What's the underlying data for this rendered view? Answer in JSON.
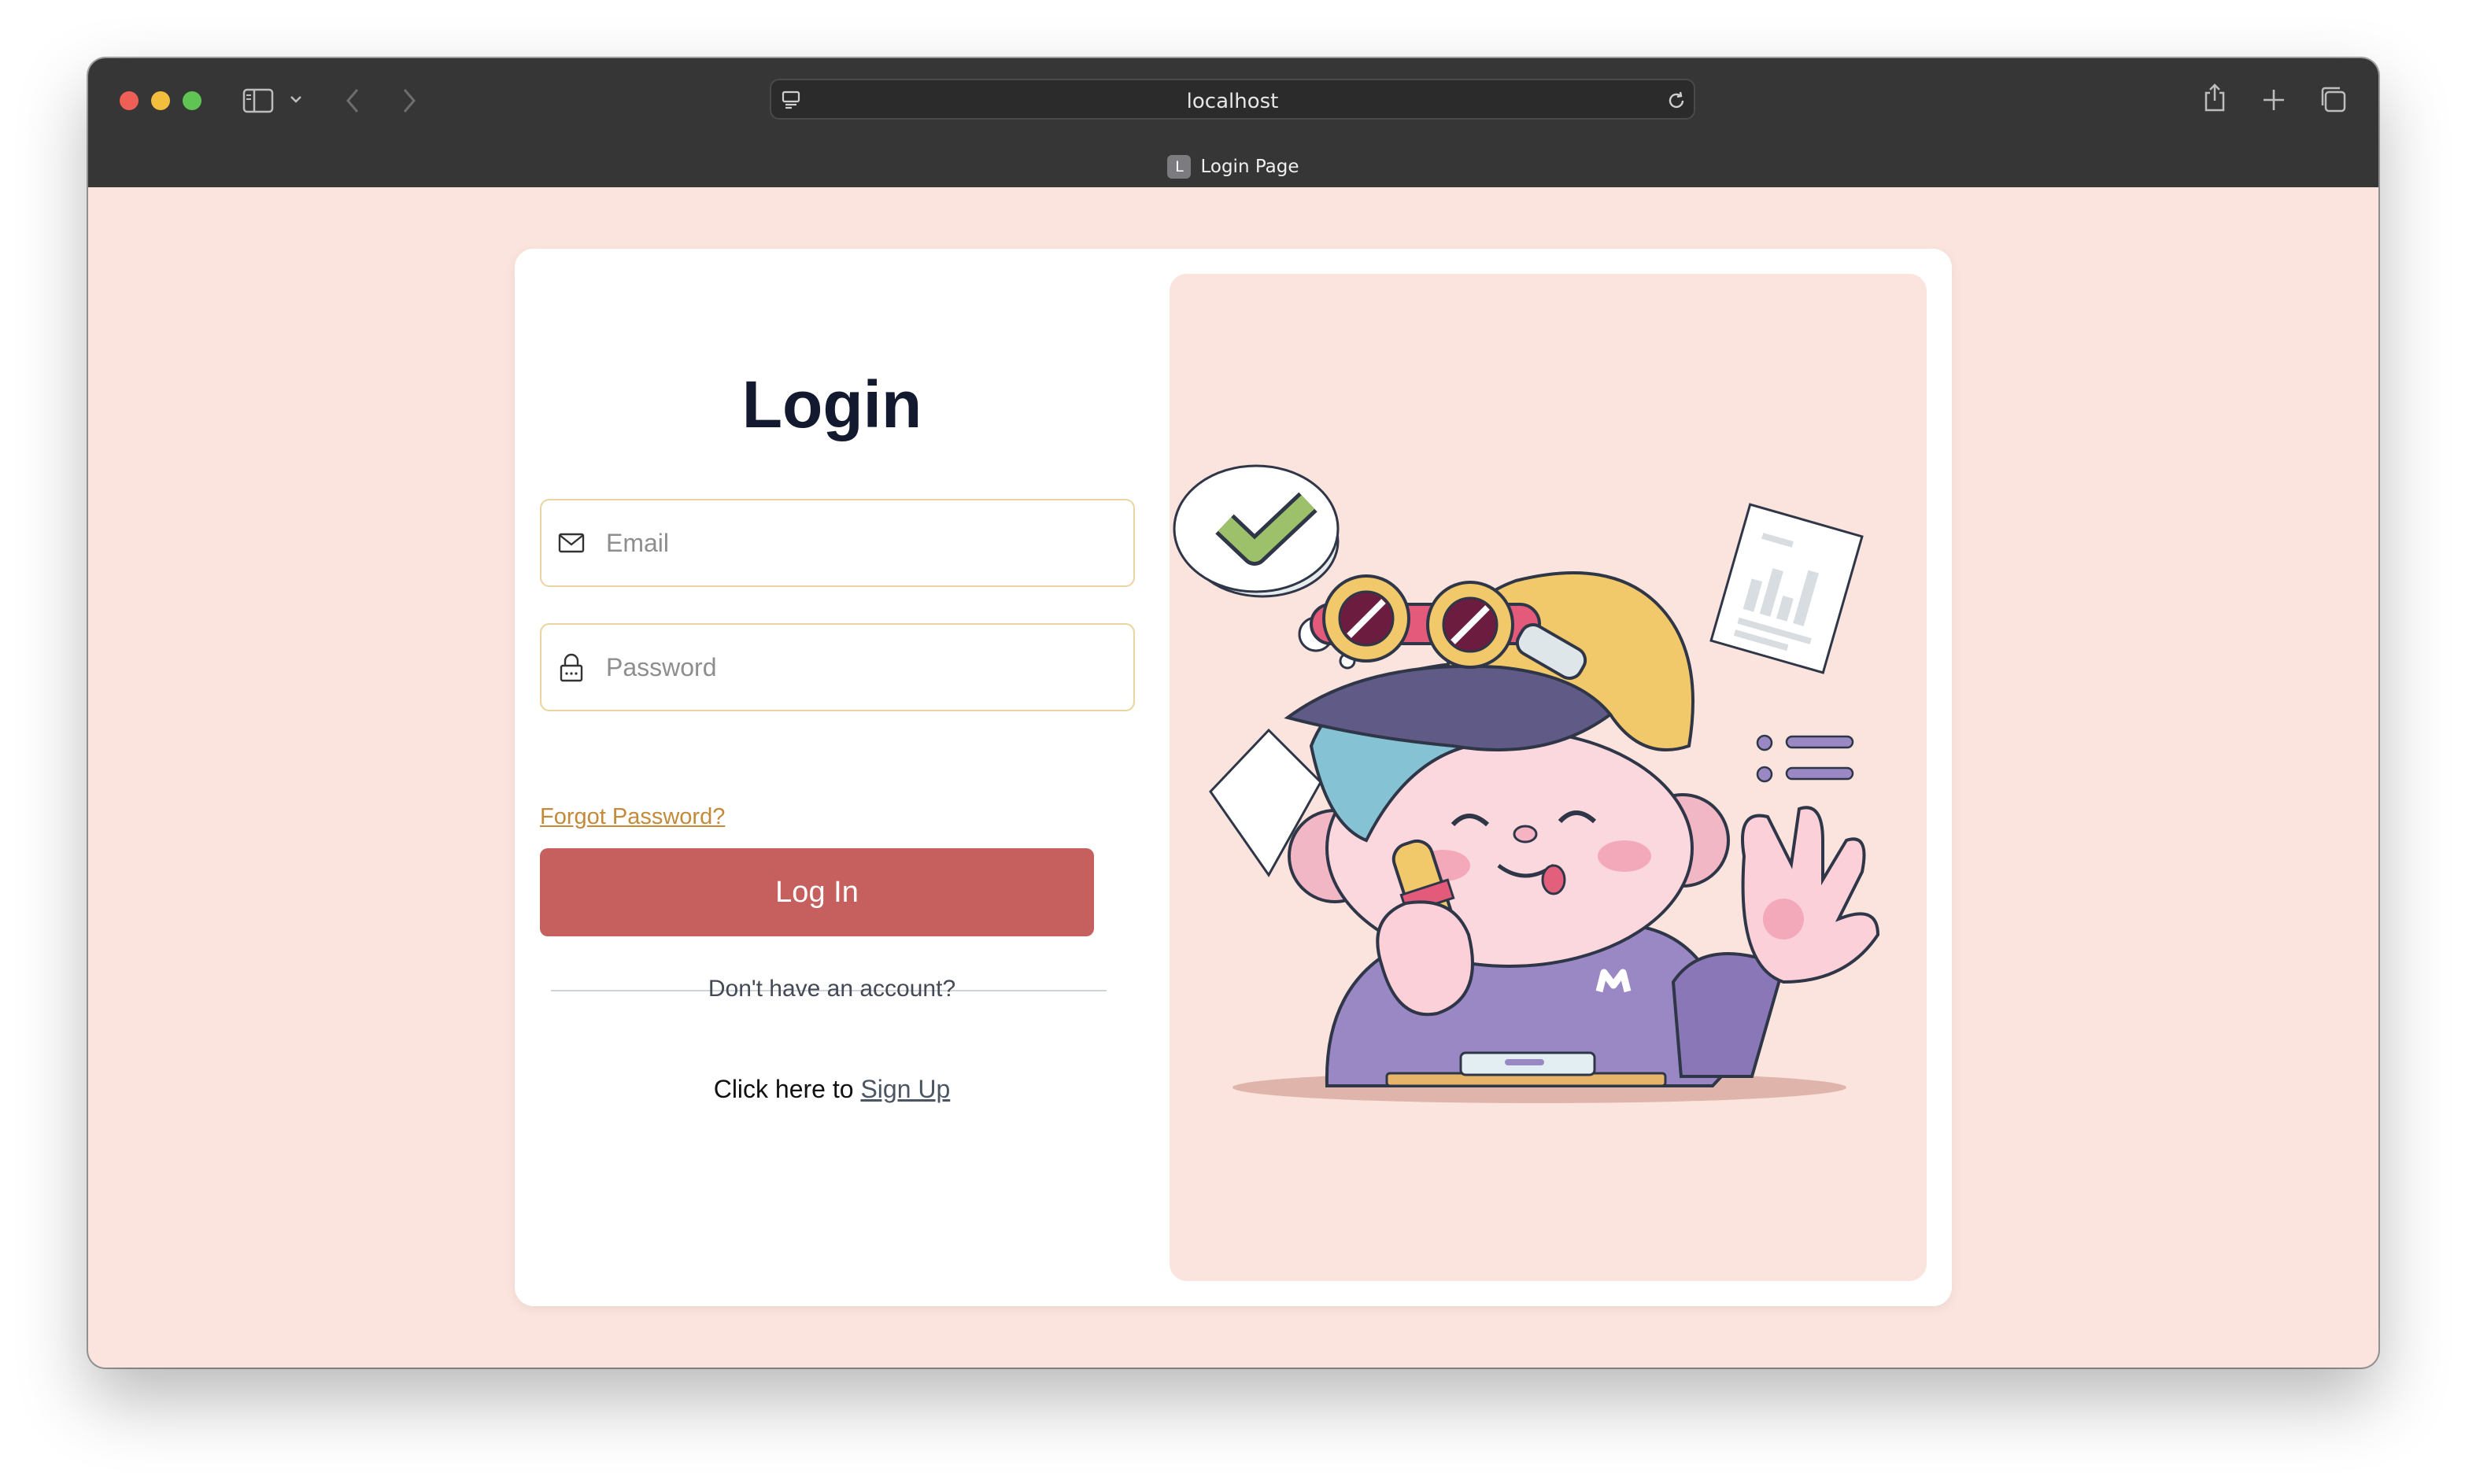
{
  "browser": {
    "url": "localhost",
    "tab": {
      "favicon_letter": "L",
      "title": "Login Page"
    },
    "icons": [
      "sidebar-icon",
      "chevron-down-icon",
      "back-icon",
      "forward-icon",
      "page-settings-icon",
      "reload-icon",
      "share-icon",
      "new-tab-icon",
      "tab-overview-icon"
    ]
  },
  "login": {
    "title": "Login",
    "email_placeholder": "Email",
    "password_placeholder": "Password",
    "forgot_label": "Forgot Password?",
    "submit_label": "Log In",
    "divider_text": "Don't have an account?",
    "signup_prefix": "Click here to ",
    "signup_link": "Sign Up"
  },
  "illustration": {
    "badge_letter": "M",
    "subject": "cartoon character with goggles waving, checkmark thought bubble, chart document"
  },
  "colors": {
    "page_bg": "#fae4dd",
    "card_bg": "#ffffff",
    "title": "#131a2f",
    "field_border": "#ecd3a2",
    "forgot_link": "#c38a3a",
    "button_bg": "#c5605f",
    "button_text": "#ffffff",
    "chrome_bg": "#363636"
  }
}
